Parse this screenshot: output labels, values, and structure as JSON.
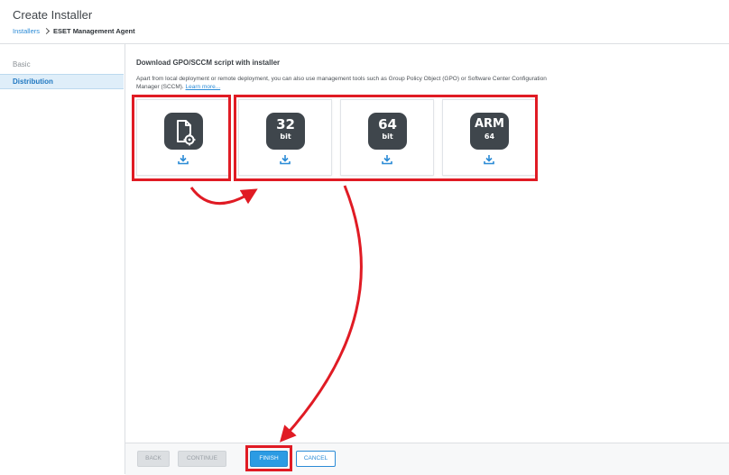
{
  "header": {
    "title": "Create Installer",
    "breadcrumb": {
      "link": "Installers",
      "current": "ESET Management Agent"
    }
  },
  "sidebar": {
    "items": [
      {
        "label": "Basic",
        "active": false
      },
      {
        "label": "Distribution",
        "active": true
      }
    ]
  },
  "main": {
    "section_title": "Download GPO/SCCM script with installer",
    "description": "Apart from local deployment or remote deployment, you can also use management tools such as Group Policy Object (GPO) or Software Center Configuration Manager (SCCM).",
    "learn_more": "Learn more...",
    "cards": [
      {
        "icon": "script-settings-icon",
        "main": "",
        "sub": ""
      },
      {
        "icon": "installer-32bit-icon",
        "main": "32",
        "sub": "bit"
      },
      {
        "icon": "installer-64bit-icon",
        "main": "64",
        "sub": "bit"
      },
      {
        "icon": "installer-arm64-icon",
        "main": "ARM",
        "sub": "64"
      }
    ]
  },
  "footer": {
    "back": "BACK",
    "continue": "CONTINUE",
    "finish": "FINISH",
    "cancel": "CANCEL"
  },
  "colors": {
    "accent": "#2b9be3",
    "annotation": "#e01b24",
    "tile": "#3f464c"
  }
}
